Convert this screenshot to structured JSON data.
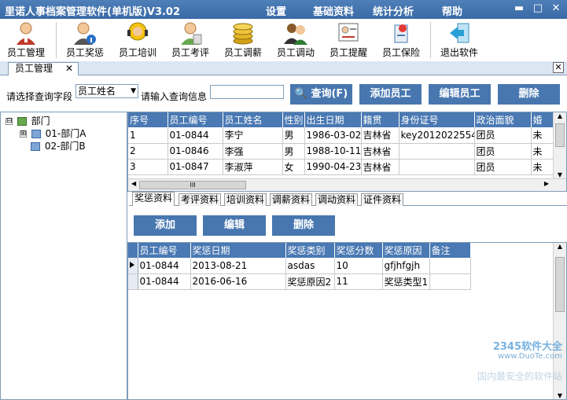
{
  "app": {
    "title": "里诺人事档案管理软件(单机版)V3.02",
    "menu": [
      "设置",
      "基础资料",
      "统计分析",
      "帮助"
    ],
    "window_buttons": [
      "▬",
      "□",
      "✕"
    ]
  },
  "toolbar": {
    "items": [
      {
        "label": "员工管理",
        "icon": "person-icon"
      },
      {
        "label": "员工奖惩",
        "icon": "person-info-icon"
      },
      {
        "label": "员工培训",
        "icon": "headset-person-icon"
      },
      {
        "label": "员工考评",
        "icon": "person-review-icon"
      },
      {
        "label": "员工调薪",
        "icon": "coins-icon"
      },
      {
        "label": "员工调动",
        "icon": "people-transfer-icon"
      },
      {
        "label": "员工提醒",
        "icon": "certificate-icon"
      },
      {
        "label": "员工保险",
        "icon": "insurance-icon"
      },
      {
        "label": "退出软件",
        "icon": "exit-icon"
      }
    ]
  },
  "tabs": {
    "doc_tab": "员工管理",
    "close": "✕",
    "close_all": "✕"
  },
  "query": {
    "field_label": "请选择查询字段",
    "field_value": "员工姓名",
    "info_label": "请输入查询信息",
    "input_value": "",
    "search_button": "查询(F)",
    "add_button": "添加员工",
    "edit_button": "编辑员工",
    "delete_button": "删除"
  },
  "tree": {
    "root": {
      "toggle": "⊟",
      "label": "部门"
    },
    "children": [
      {
        "toggle": "⊞",
        "label": "01-部门A"
      },
      {
        "toggle": "",
        "label": "02-部门B"
      }
    ]
  },
  "employees": {
    "columns": [
      "序号",
      "员工编号",
      "员工姓名",
      "性别",
      "出生日期",
      "籍贯",
      "身份证号",
      "政治面貌",
      "婚"
    ],
    "rows": [
      [
        "1",
        "01-0844",
        "李宁",
        "男",
        "1986-03-02",
        "吉林省",
        "key2012022554",
        "团员",
        "未"
      ],
      [
        "2",
        "01-0846",
        "李强",
        "男",
        "1988-10-11",
        "吉林省",
        "",
        "团员",
        "未"
      ],
      [
        "3",
        "01-0847",
        "李淑萍",
        "女",
        "1990-04-23",
        "吉林省",
        "",
        "团员",
        "未"
      ]
    ],
    "hscroll_grip": "III"
  },
  "subtabs": [
    "奖惩资料",
    "考评资料",
    "培训资料",
    "调薪资料",
    "调动资料",
    "证件资料"
  ],
  "sub_buttons": {
    "add": "添加",
    "edit": "编辑",
    "delete": "删除"
  },
  "rewards": {
    "columns": [
      "员工编号",
      "奖惩日期",
      "奖惩类别",
      "奖惩分数",
      "奖惩原因",
      "备注"
    ],
    "rows": [
      [
        "01-0844",
        "2013-08-21",
        "asdas",
        "10",
        "gfjhfgjh",
        ""
      ],
      [
        "01-0844",
        "2016-06-16",
        "奖惩原因2",
        "11",
        "奖惩类型1",
        ""
      ]
    ]
  },
  "watermark": {
    "line1": "2345软件大全",
    "line2": "www.DuoTe.com",
    "line3": "国内最安全的软件站"
  },
  "colors": {
    "header_blue": "#4a79b3",
    "title_blue": "#3a6aa6",
    "button_blue": "#4877b0"
  }
}
